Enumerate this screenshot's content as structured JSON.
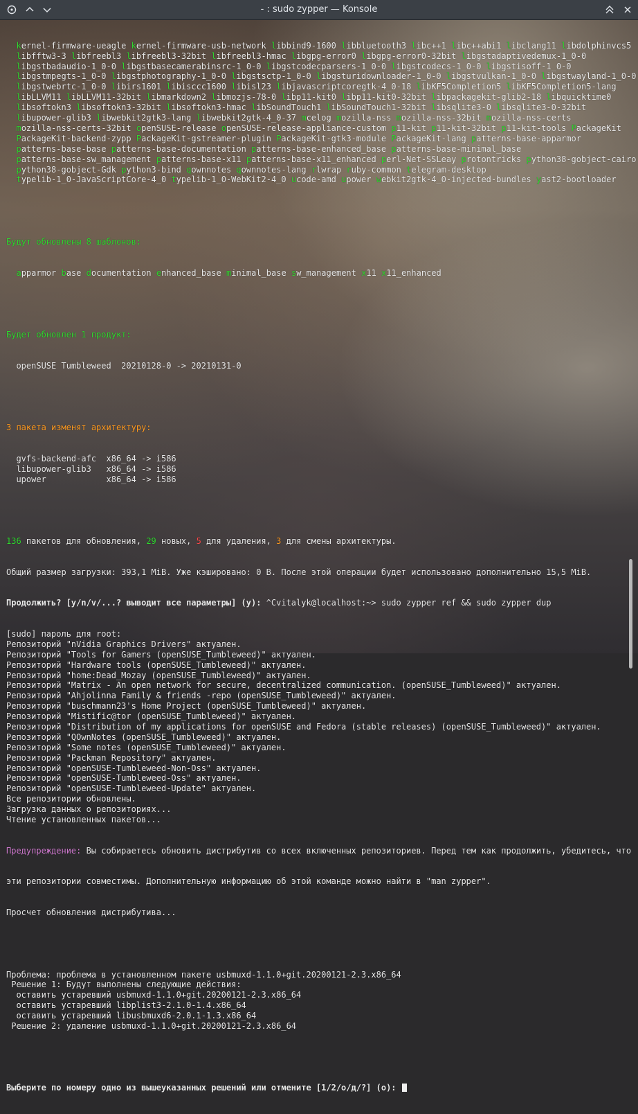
{
  "window": {
    "title": "- : sudo zypper — Konsole"
  },
  "terminal": {
    "pkg_lines": [
      "kernel-firmware-ueagle kernel-firmware-usb-network libbind9-1600 libbluetooth3 libc++1 libc++abi1 libclang11 libdolphinvcs5",
      "libfftw3-3 libfreebl3 libfreebl3-32bit libfreebl3-hmac libgpg-error0 libgpg-error0-32bit libgstadaptivedemux-1_0-0",
      "libgstbadaudio-1_0-0 libgstbasecamerabinsrc-1_0-0 libgstcodecparsers-1_0-0 libgstcodecs-1_0-0 libgstisoff-1_0-0",
      "libgstmpegts-1_0-0 libgstphotography-1_0-0 libgstsctp-1_0-0 libgsturidownloader-1_0-0 libgstvulkan-1_0-0 libgstwayland-1_0-0",
      "libgstwebrtc-1_0-0 libirs1601 libisccc1600 libisl23 libjavascriptcoregtk-4_0-18 libKF5Completion5 libKF5Completion5-lang",
      "libLLVM11 libLLVM11-32bit libmarkdown2 libmozjs-78-0 libp11-kit0 libp11-kit0-32bit libpackagekit-glib2-18 libquicktime0",
      "libsoftokn3 libsoftokn3-32bit libsoftokn3-hmac libSoundTouch1 libSoundTouch1-32bit libsqlite3-0 libsqlite3-0-32bit",
      "libupower-glib3 libwebkit2gtk3-lang libwebkit2gtk-4_0-37 mcelog mozilla-nss mozilla-nss-32bit mozilla-nss-certs",
      "mozilla-nss-certs-32bit openSUSE-release openSUSE-release-appliance-custom p11-kit p11-kit-32bit p11-kit-tools PackageKit",
      "PackageKit-backend-zypp PackageKit-gstreamer-plugin PackageKit-gtk3-module PackageKit-lang patterns-base-apparmor",
      "patterns-base-base patterns-base-documentation patterns-base-enhanced_base patterns-base-minimal_base",
      "patterns-base-sw_management patterns-base-x11 patterns-base-x11_enhanced perl-Net-SSLeay protontricks python38-gobject-cairo",
      "python38-gobject-Gdk python3-bind qownnotes qownnotes-lang rlwrap ruby-common telegram-desktop",
      "typelib-1_0-JavaScriptCore-4_0 typelib-1_0-WebKit2-4_0 ucode-amd upower webkit2gtk-4_0-injected-bundles yast2-bootloader"
    ],
    "patterns_header": "Будут обновлены 8 шаблонов:",
    "patterns_line": "apparmor base documentation enhanced_base minimal_base sw_management x11 x11_enhanced",
    "product_header": "Будет обновлен 1 продукт:",
    "product_line": "  openSUSE Tumbleweed  20210128-0 -> 20210131-0",
    "arch_header": "3 пакета изменят архитектуру:",
    "arch_lines": [
      "  gvfs-backend-afc  x86_64 -> i586",
      "  libupower-glib3   x86_64 -> i586",
      "  upower            x86_64 -> i586"
    ],
    "summary": {
      "n_update": "136",
      "t1": " пакетов для обновления, ",
      "n_new": "29",
      "t2": " новых, ",
      "n_remove": "5",
      "t3": " для удаления, ",
      "n_arch": "3",
      "t4": " для смены архитектуры."
    },
    "download_line": "Общий размер загрузки: 393,1 MiB. Уже кэшировано: 0 B. После этой операции будет использовано дополнительно 15,5 MiB.",
    "continue_prompt": "Продолжить? [y/n/v/...? выводит все параметры] (y): ",
    "command": "^Cvitalyk@localhost:~> sudo zypper ref && sudo zypper dup",
    "log_lines": [
      "[sudo] пароль для root:",
      "Репозиторий \"nVidia Graphics Drivers\" актуален.",
      "Репозиторий \"Tools for Gamers (openSUSE_Tumbleweed)\" актуален.",
      "Репозиторий \"Hardware tools (openSUSE_Tumbleweed)\" актуален.",
      "Репозиторий \"home:Dead_Mozay (openSUSE_Tumbleweed)\" актуален.",
      "Репозиторий \"Matrix - An open network for secure, decentralized communication. (openSUSE_Tumbleweed)\" актуален.",
      "Репозиторий \"Ahjolinna Family & friends -repo (openSUSE_Tumbleweed)\" актуален.",
      "Репозиторий \"buschmann23's Home Project (openSUSE_Tumbleweed)\" актуален.",
      "Репозиторий \"Mistific@tor (openSUSE_Tumbleweed)\" актуален.",
      "Репозиторий \"Distribution of my applications for openSUSE and Fedora (stable releases) (openSUSE_Tumbleweed)\" актуален.",
      "Репозиторий \"QOwnNotes (openSUSE_Tumbleweed)\" актуален.",
      "Репозиторий \"Some notes (openSUSE_Tumbleweed)\" актуален.",
      "Репозиторий \"Packman Repository\" актуален.",
      "Репозиторий \"openSUSE-Tumbleweed-Non-Oss\" актуален.",
      "Репозиторий \"openSUSE-Tumbleweed-Oss\" актуален.",
      "Репозиторий \"openSUSE-Tumbleweed-Update\" актуален.",
      "Все репозитории обновлены.",
      "Загрузка данных о репозиториях...",
      "Чтение установленных пакетов..."
    ],
    "warning_label": "Предупреждение:",
    "warning_text": " Вы собираетесь обновить дистрибутив со всех включенных репозиториев. Перед тем как продолжить, убедитесь, что",
    "warning_text2": "эти репозитории совместимы. Дополнительную информацию об этой команде можно найти в \"man zypper\".",
    "calc_line": "Просчет обновления дистрибутива...",
    "problem_lines": [
      "Проблема: проблема в установленном пакете usbmuxd-1.1.0+git.20200121-2.3.x86_64",
      " Решение 1: Будут выполнены следующие действия:",
      "  оставить устаревший usbmuxd-1.1.0+git.20200121-2.3.x86_64",
      "  оставить устаревший libplist3-2.1.0-1.4.x86_64",
      "  оставить устаревший libusbmuxd6-2.0.1-1.3.x86_64",
      " Решение 2: удаление usbmuxd-1.1.0+git.20200121-2.3.x86_64"
    ],
    "final_prompt": "Выберите по номеру одно из вышеуказанных решений или отмените [1/2/о/д/?] (о): "
  }
}
